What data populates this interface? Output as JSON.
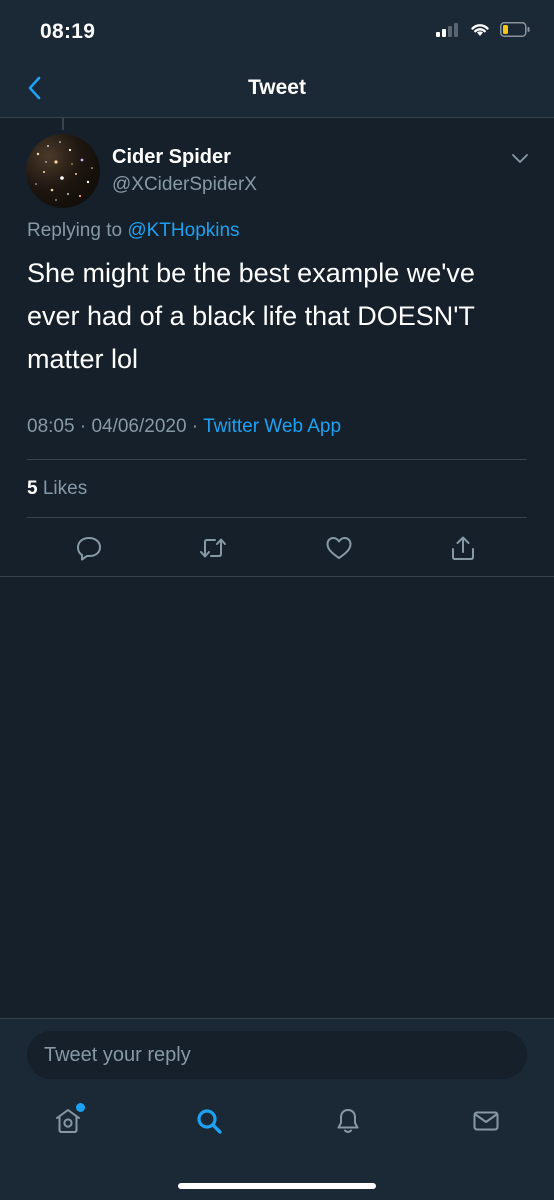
{
  "status_bar": {
    "time": "08:19"
  },
  "nav": {
    "title": "Tweet",
    "back_icon": "chevron-left-icon"
  },
  "tweet": {
    "author_name": "Cider Spider",
    "author_handle": "@XCiderSpiderX",
    "replying_prefix": "Replying to ",
    "replying_to": "@KTHopkins",
    "text": "She might be the best example we've ever had of a black life that DOESN'T matter lol",
    "time": "08:05",
    "separator": " · ",
    "date": "04/06/2020",
    "source": "Twitter Web App",
    "likes_count": "5",
    "likes_label": " Likes"
  },
  "actions": [
    "reply-icon",
    "retweet-icon",
    "like-icon",
    "share-icon"
  ],
  "reply_box": {
    "placeholder": "Tweet your reply"
  },
  "tabs": [
    "home-icon",
    "search-icon",
    "notifications-icon",
    "messages-icon"
  ],
  "colors": {
    "background": "#15202b",
    "bar": "#1b2836",
    "accent": "#1da1f2",
    "secondary_text": "#8899a6",
    "border": "#38444d"
  }
}
